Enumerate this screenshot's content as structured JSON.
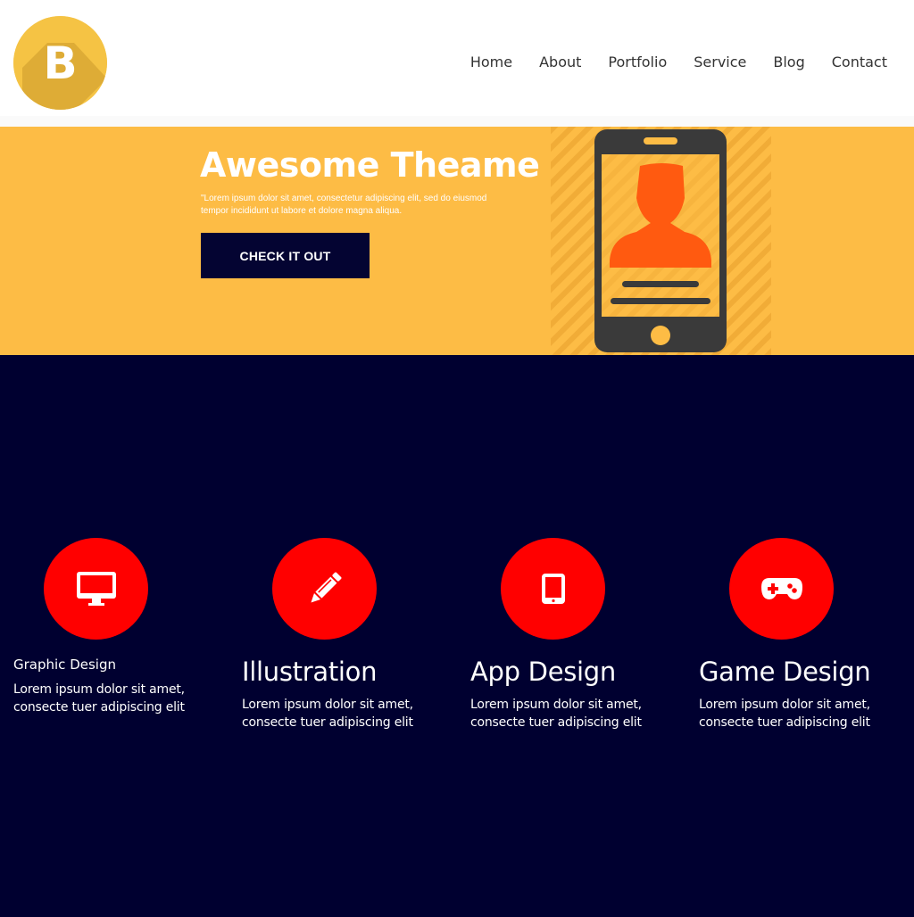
{
  "header": {
    "logo_letter": "B",
    "logo_color": "#f5c344",
    "nav": [
      "Home",
      "About",
      "Portfolio",
      "Service",
      "Blog",
      "Contact"
    ]
  },
  "hero": {
    "background": "#fdbc45",
    "title": "Awesome Theame",
    "text": "\"Lorem ipsum dolor sit amet, consectetur adipiscing elit, sed do eiusmod tempor incididunt ut labore et dolore magna aliqua.",
    "button_label": "CHECK IT OUT",
    "illustration": "smartphone-profile-icon"
  },
  "services": {
    "background": "#000030",
    "accent": "#ff0000",
    "items": [
      {
        "icon": "monitor-icon",
        "title": "Graphic Design",
        "desc": "Lorem ipsum dolor sit amet, consecte tuer adipiscing elit"
      },
      {
        "icon": "pencil-icon",
        "title": "Illustration",
        "desc": "Lorem ipsum dolor sit amet, consecte tuer adipiscing elit"
      },
      {
        "icon": "tablet-icon",
        "title": "App Design",
        "desc": "Lorem ipsum dolor sit amet, consecte tuer adipiscing elit"
      },
      {
        "icon": "gamepad-icon",
        "title": "Game Design",
        "desc": "Lorem ipsum dolor sit amet, consecte tuer adipiscing elit"
      }
    ]
  }
}
